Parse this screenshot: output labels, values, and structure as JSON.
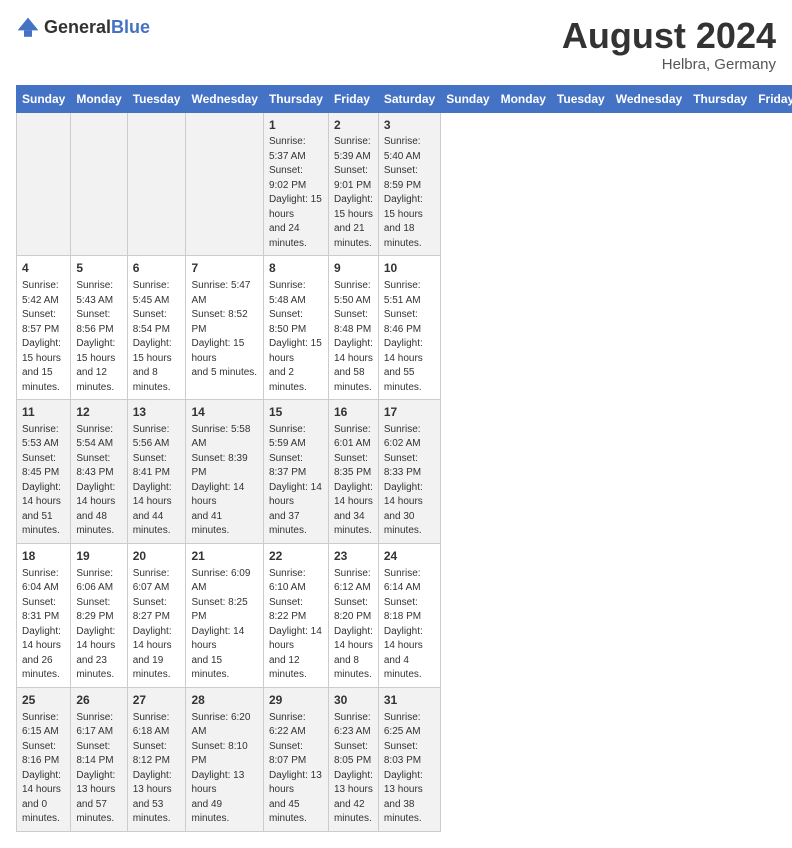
{
  "header": {
    "logo_general": "General",
    "logo_blue": "Blue",
    "month_title": "August 2024",
    "location": "Helbra, Germany"
  },
  "days_of_week": [
    "Sunday",
    "Monday",
    "Tuesday",
    "Wednesday",
    "Thursday",
    "Friday",
    "Saturday"
  ],
  "weeks": [
    [
      {
        "day": "",
        "info": ""
      },
      {
        "day": "",
        "info": ""
      },
      {
        "day": "",
        "info": ""
      },
      {
        "day": "",
        "info": ""
      },
      {
        "day": "1",
        "info": "Sunrise: 5:37 AM\nSunset: 9:02 PM\nDaylight: 15 hours\nand 24 minutes."
      },
      {
        "day": "2",
        "info": "Sunrise: 5:39 AM\nSunset: 9:01 PM\nDaylight: 15 hours\nand 21 minutes."
      },
      {
        "day": "3",
        "info": "Sunrise: 5:40 AM\nSunset: 8:59 PM\nDaylight: 15 hours\nand 18 minutes."
      }
    ],
    [
      {
        "day": "4",
        "info": "Sunrise: 5:42 AM\nSunset: 8:57 PM\nDaylight: 15 hours\nand 15 minutes."
      },
      {
        "day": "5",
        "info": "Sunrise: 5:43 AM\nSunset: 8:56 PM\nDaylight: 15 hours\nand 12 minutes."
      },
      {
        "day": "6",
        "info": "Sunrise: 5:45 AM\nSunset: 8:54 PM\nDaylight: 15 hours\nand 8 minutes."
      },
      {
        "day": "7",
        "info": "Sunrise: 5:47 AM\nSunset: 8:52 PM\nDaylight: 15 hours\nand 5 minutes."
      },
      {
        "day": "8",
        "info": "Sunrise: 5:48 AM\nSunset: 8:50 PM\nDaylight: 15 hours\nand 2 minutes."
      },
      {
        "day": "9",
        "info": "Sunrise: 5:50 AM\nSunset: 8:48 PM\nDaylight: 14 hours\nand 58 minutes."
      },
      {
        "day": "10",
        "info": "Sunrise: 5:51 AM\nSunset: 8:46 PM\nDaylight: 14 hours\nand 55 minutes."
      }
    ],
    [
      {
        "day": "11",
        "info": "Sunrise: 5:53 AM\nSunset: 8:45 PM\nDaylight: 14 hours\nand 51 minutes."
      },
      {
        "day": "12",
        "info": "Sunrise: 5:54 AM\nSunset: 8:43 PM\nDaylight: 14 hours\nand 48 minutes."
      },
      {
        "day": "13",
        "info": "Sunrise: 5:56 AM\nSunset: 8:41 PM\nDaylight: 14 hours\nand 44 minutes."
      },
      {
        "day": "14",
        "info": "Sunrise: 5:58 AM\nSunset: 8:39 PM\nDaylight: 14 hours\nand 41 minutes."
      },
      {
        "day": "15",
        "info": "Sunrise: 5:59 AM\nSunset: 8:37 PM\nDaylight: 14 hours\nand 37 minutes."
      },
      {
        "day": "16",
        "info": "Sunrise: 6:01 AM\nSunset: 8:35 PM\nDaylight: 14 hours\nand 34 minutes."
      },
      {
        "day": "17",
        "info": "Sunrise: 6:02 AM\nSunset: 8:33 PM\nDaylight: 14 hours\nand 30 minutes."
      }
    ],
    [
      {
        "day": "18",
        "info": "Sunrise: 6:04 AM\nSunset: 8:31 PM\nDaylight: 14 hours\nand 26 minutes."
      },
      {
        "day": "19",
        "info": "Sunrise: 6:06 AM\nSunset: 8:29 PM\nDaylight: 14 hours\nand 23 minutes."
      },
      {
        "day": "20",
        "info": "Sunrise: 6:07 AM\nSunset: 8:27 PM\nDaylight: 14 hours\nand 19 minutes."
      },
      {
        "day": "21",
        "info": "Sunrise: 6:09 AM\nSunset: 8:25 PM\nDaylight: 14 hours\nand 15 minutes."
      },
      {
        "day": "22",
        "info": "Sunrise: 6:10 AM\nSunset: 8:22 PM\nDaylight: 14 hours\nand 12 minutes."
      },
      {
        "day": "23",
        "info": "Sunrise: 6:12 AM\nSunset: 8:20 PM\nDaylight: 14 hours\nand 8 minutes."
      },
      {
        "day": "24",
        "info": "Sunrise: 6:14 AM\nSunset: 8:18 PM\nDaylight: 14 hours\nand 4 minutes."
      }
    ],
    [
      {
        "day": "25",
        "info": "Sunrise: 6:15 AM\nSunset: 8:16 PM\nDaylight: 14 hours\nand 0 minutes."
      },
      {
        "day": "26",
        "info": "Sunrise: 6:17 AM\nSunset: 8:14 PM\nDaylight: 13 hours\nand 57 minutes."
      },
      {
        "day": "27",
        "info": "Sunrise: 6:18 AM\nSunset: 8:12 PM\nDaylight: 13 hours\nand 53 minutes."
      },
      {
        "day": "28",
        "info": "Sunrise: 6:20 AM\nSunset: 8:10 PM\nDaylight: 13 hours\nand 49 minutes."
      },
      {
        "day": "29",
        "info": "Sunrise: 6:22 AM\nSunset: 8:07 PM\nDaylight: 13 hours\nand 45 minutes."
      },
      {
        "day": "30",
        "info": "Sunrise: 6:23 AM\nSunset: 8:05 PM\nDaylight: 13 hours\nand 42 minutes."
      },
      {
        "day": "31",
        "info": "Sunrise: 6:25 AM\nSunset: 8:03 PM\nDaylight: 13 hours\nand 38 minutes."
      }
    ]
  ]
}
